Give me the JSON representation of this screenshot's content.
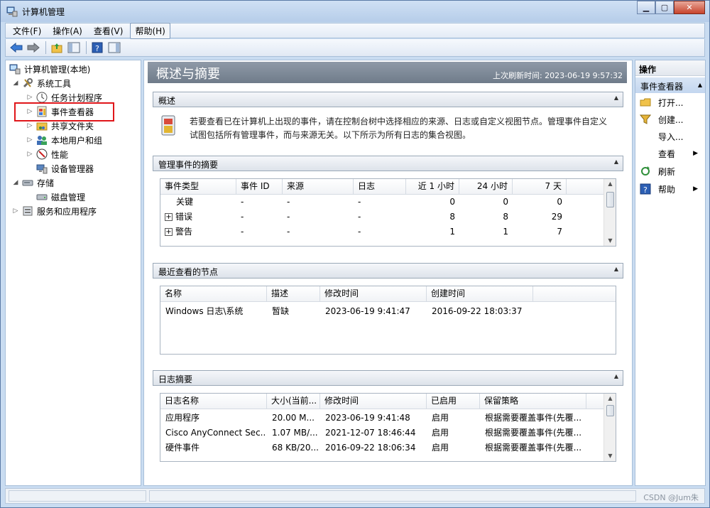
{
  "window": {
    "title": "计算机管理",
    "controls": {
      "minimize": "▁",
      "maximize": "▢",
      "close": "✕"
    }
  },
  "menu": [
    "文件(F)",
    "操作(A)",
    "查看(V)",
    "帮助(H)"
  ],
  "tree": {
    "root": "计算机管理(本地)",
    "system_tools": "系统工具",
    "task_scheduler": "任务计划程序",
    "event_viewer": "事件查看器",
    "shared_folders": "共享文件夹",
    "local_users": "本地用户和组",
    "performance": "性能",
    "device_manager": "设备管理器",
    "storage": "存储",
    "disk_management": "磁盘管理",
    "services_apps": "服务和应用程序"
  },
  "center": {
    "title": "概述与摘要",
    "last_refresh": "上次刷新时间: 2023-06-19 9:57:32",
    "overview": {
      "header": "概述",
      "text": "若要查看已在计算机上出现的事件，请在控制台树中选择相应的来源、日志或自定义视图节点。管理事件自定义试图包括所有管理事件，而与来源无关。以下所示为所有日志的集合视图。"
    },
    "summary": {
      "header": "管理事件的摘要",
      "columns": [
        "事件类型",
        "事件 ID",
        "来源",
        "日志",
        "近 1 小时",
        "24 小时",
        "7 天"
      ],
      "rows": [
        {
          "type": "关键",
          "id": "-",
          "source": "-",
          "log": "-",
          "h1": "0",
          "h24": "0",
          "d7": "0"
        },
        {
          "type": "错误",
          "id": "-",
          "source": "-",
          "log": "-",
          "h1": "8",
          "h24": "8",
          "d7": "29"
        },
        {
          "type": "警告",
          "id": "-",
          "source": "-",
          "log": "-",
          "h1": "1",
          "h24": "1",
          "d7": "7"
        }
      ]
    },
    "recent": {
      "header": "最近查看的节点",
      "columns": [
        "名称",
        "描述",
        "修改时间",
        "创建时间"
      ],
      "rows": [
        {
          "name": "Windows 日志\\系统",
          "desc": "暂缺",
          "modified": "2023-06-19 9:41:47",
          "created": "2016-09-22 18:03:37"
        }
      ]
    },
    "logs": {
      "header": "日志摘要",
      "columns": [
        "日志名称",
        "大小(当前...",
        "修改时间",
        "已启用",
        "保留策略"
      ],
      "rows": [
        {
          "name": "应用程序",
          "size": "20.00 M...",
          "modified": "2023-06-19 9:41:48",
          "enabled": "启用",
          "policy": "根据需要覆盖事件(先覆..."
        },
        {
          "name": "Cisco AnyConnect Sec...",
          "size": "1.07 MB/...",
          "modified": "2021-12-07 18:46:44",
          "enabled": "启用",
          "policy": "根据需要覆盖事件(先覆..."
        },
        {
          "name": "硬件事件",
          "size": "68 KB/20...",
          "modified": "2016-09-22 18:06:34",
          "enabled": "启用",
          "policy": "根据需要覆盖事件(先覆..."
        }
      ]
    }
  },
  "actions": {
    "header": "操作",
    "section": "事件查看器",
    "items": [
      {
        "label": "打开..."
      },
      {
        "label": "创建..."
      },
      {
        "label": "导入..."
      },
      {
        "label": "查看"
      },
      {
        "label": "刷新"
      },
      {
        "label": "帮助"
      }
    ]
  },
  "status": {
    "watermark": "CSDN @Jum朱"
  }
}
